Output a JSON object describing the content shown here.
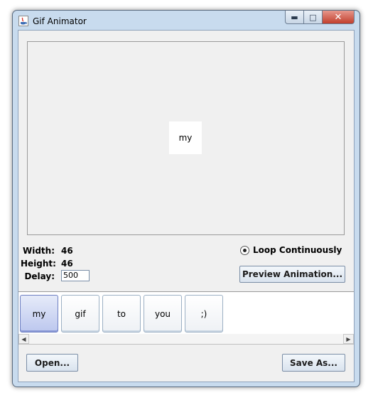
{
  "window": {
    "title": "Gif Animator",
    "controls": {
      "minimize_icon": "minimize-icon",
      "maximize_icon": "maximize-icon",
      "close_icon": "close-icon"
    }
  },
  "preview": {
    "current_frame_text": "my"
  },
  "info": {
    "width_label": "Width:",
    "width_value": "46",
    "height_label": "Height:",
    "height_value": "46",
    "delay_label": "Delay:",
    "delay_value": "500"
  },
  "options": {
    "loop_label": "Loop Continuously",
    "loop_selected": true,
    "preview_button": "Preview Animation..."
  },
  "frames": [
    {
      "label": "my",
      "selected": true
    },
    {
      "label": "gif",
      "selected": false
    },
    {
      "label": "to",
      "selected": false
    },
    {
      "label": "you",
      "selected": false
    },
    {
      "label": ";)",
      "selected": false
    }
  ],
  "footer": {
    "open_button": "Open...",
    "save_button": "Save As..."
  }
}
